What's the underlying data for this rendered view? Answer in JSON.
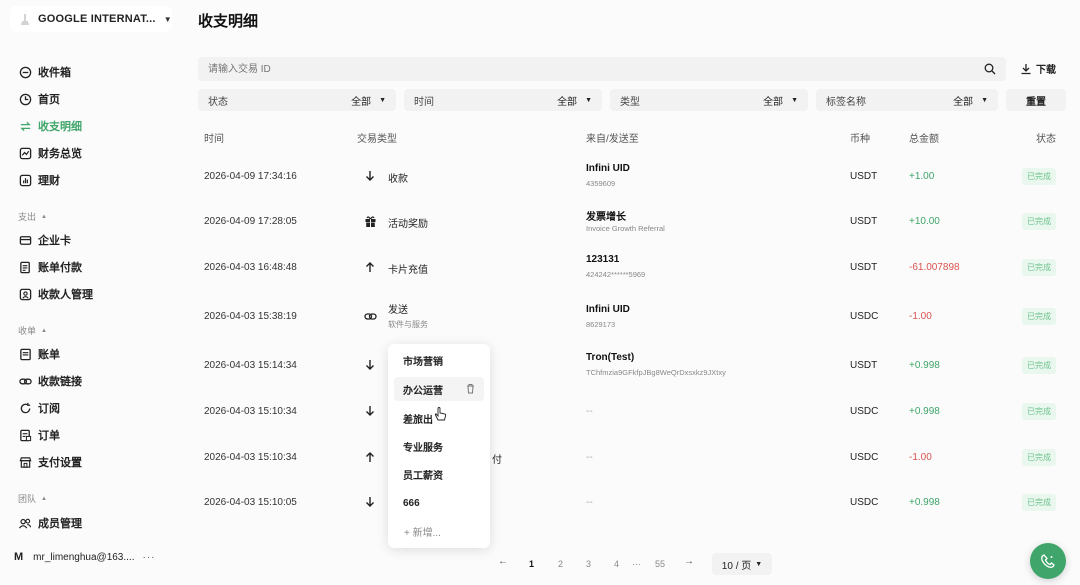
{
  "sidebar": {
    "org_name": "GOOGLE INTERNAT...",
    "items_top": [
      {
        "label": "收件箱",
        "icon": "inbox-icon"
      },
      {
        "label": "首页",
        "icon": "home-icon"
      },
      {
        "label": "收支明细",
        "icon": "transfer-icon",
        "active": true
      },
      {
        "label": "财务总览",
        "icon": "chart-icon"
      },
      {
        "label": "理财",
        "icon": "invest-icon"
      }
    ],
    "section_expense": "支出",
    "items_expense": [
      {
        "label": "企业卡"
      },
      {
        "label": "账单付款"
      },
      {
        "label": "收款人管理"
      }
    ],
    "section_income": "收单",
    "items_income": [
      {
        "label": "账单"
      },
      {
        "label": "收款链接"
      },
      {
        "label": "订阅"
      },
      {
        "label": "订单"
      },
      {
        "label": "支付设置"
      }
    ],
    "section_team": "团队",
    "items_team": [
      {
        "label": "成员管理"
      }
    ],
    "user_initial": "M",
    "user_email": "mr_limenghua@163....",
    "user_more": "···"
  },
  "page_title": "收支明细",
  "search": {
    "placeholder": "请输入交易 ID"
  },
  "download_label": "下载",
  "filters": [
    {
      "label": "状态",
      "value": "全部"
    },
    {
      "label": "时间",
      "value": "全部"
    },
    {
      "label": "类型",
      "value": "全部"
    },
    {
      "label": "标签名称",
      "value": "全部"
    }
  ],
  "reset_label": "重置",
  "columns": [
    "时间",
    "交易类型",
    "来自/发送至",
    "币种",
    "总金额",
    "状态"
  ],
  "rows": [
    {
      "time": "2026-04-09 17:34:16",
      "type": "收款",
      "type_sub": "",
      "icon": "arrow-down",
      "cp": "Infini UID",
      "cp_sub": "4359609",
      "currency": "USDT",
      "amount": "+1.00",
      "sign": "pos",
      "status": "已完成"
    },
    {
      "time": "2026-04-09 17:28:05",
      "type": "活动奖励",
      "type_sub": "",
      "icon": "gift",
      "cp": "发票增长",
      "cp_sub": "Invoice Growth Referral",
      "currency": "USDT",
      "amount": "+10.00",
      "sign": "pos",
      "status": "已完成"
    },
    {
      "time": "2026-04-03 16:48:48",
      "type": "卡片充值",
      "type_sub": "",
      "icon": "arrow-up",
      "cp": "123131",
      "cp_sub": "424242******5969",
      "currency": "USDT",
      "amount": "-61.007898",
      "sign": "neg",
      "status": "已完成"
    },
    {
      "time": "2026-04-03 15:38:19",
      "type": "发送",
      "type_sub": "软件与服务",
      "icon": "link",
      "cp": "Infini UID",
      "cp_sub": "8629173",
      "currency": "USDC",
      "amount": "-1.00",
      "sign": "neg",
      "status": "已完成"
    },
    {
      "time": "2026-04-03 15:14:34",
      "type": "",
      "type_sub": "",
      "icon": "arrow-down",
      "cp": "Tron(Test)",
      "cp_sub": "TChfmzia9GFkfpJBg8WeQrDxsxkz9JXtxy",
      "currency": "USDT",
      "amount": "+0.998",
      "sign": "pos",
      "status": "已完成"
    },
    {
      "time": "2026-04-03 15:10:34",
      "type": "",
      "type_sub": "",
      "icon": "arrow-down",
      "cp": "",
      "cp_sub": "",
      "dash": "--",
      "currency": "USDC",
      "amount": "+0.998",
      "sign": "pos",
      "status": "已完成"
    },
    {
      "time": "2026-04-03 15:10:34",
      "type": "",
      "type_sub": "",
      "icon": "arrow-up",
      "cp": "",
      "cp_sub": "",
      "dash": "--",
      "currency": "USDC",
      "amount": "-1.00",
      "sign": "neg",
      "status": "已完成"
    },
    {
      "time": "2026-04-03 15:10:05",
      "type": "",
      "type_sub": "",
      "icon": "arrow-down",
      "cp": "",
      "cp_sub": "",
      "dash": "--",
      "currency": "USDC",
      "amount": "+0.998",
      "sign": "pos",
      "status": "已完成"
    }
  ],
  "row_extra_text": "付",
  "popup": {
    "options": [
      "市场营销",
      "办公运营",
      "差旅出",
      "专业服务",
      "员工薪资",
      "666"
    ],
    "add_label": "+ 新增..."
  },
  "pagination": {
    "prev": "←",
    "pages": [
      "1",
      "2",
      "3",
      "4",
      "···",
      "55"
    ],
    "next": "→",
    "per_page": "10 / 页"
  },
  "colors": {
    "accent": "#3fa56a",
    "negative": "#d9534f"
  }
}
